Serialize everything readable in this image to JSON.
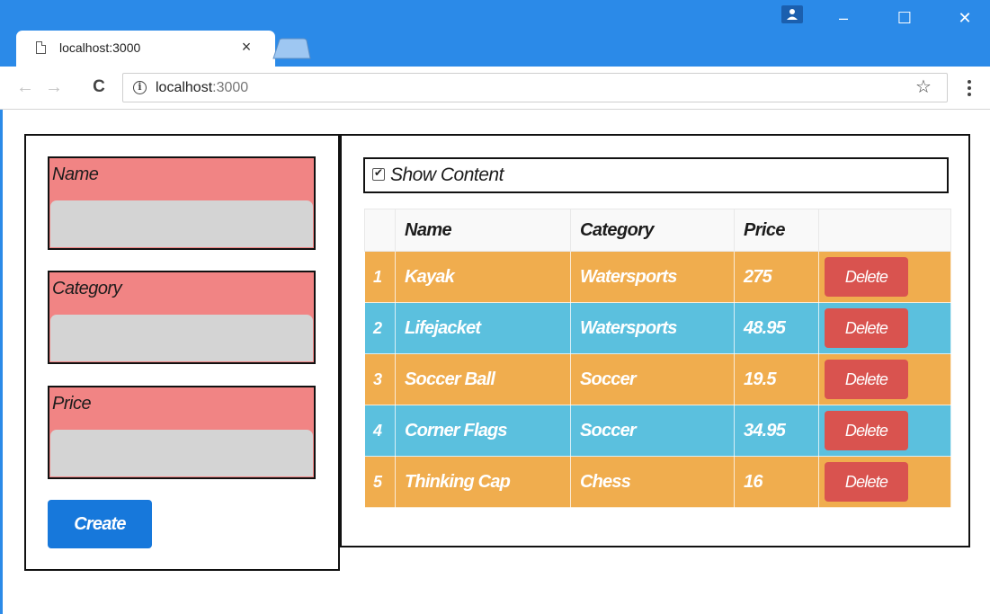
{
  "browser": {
    "tab_title": "localhost:3000",
    "tab_close": "×",
    "url_host": "localhost",
    "url_port": ":3000",
    "window_buttons": {
      "minimize": "–",
      "maximize": "☐",
      "close": "✕"
    }
  },
  "form": {
    "fields": [
      {
        "label": "Name",
        "value": ""
      },
      {
        "label": "Category",
        "value": ""
      },
      {
        "label": "Price",
        "value": ""
      }
    ],
    "create_label": "Create"
  },
  "list": {
    "show_content_label": "Show Content",
    "show_content_checked": true,
    "columns": [
      "",
      "Name",
      "Category",
      "Price",
      ""
    ],
    "rows": [
      {
        "index": "1",
        "name": "Kayak",
        "category": "Watersports",
        "price": "275",
        "action": "Delete",
        "color": "orange"
      },
      {
        "index": "2",
        "name": "Lifejacket",
        "category": "Watersports",
        "price": "48.95",
        "action": "Delete",
        "color": "blue"
      },
      {
        "index": "3",
        "name": "Soccer Ball",
        "category": "Soccer",
        "price": "19.5",
        "action": "Delete",
        "color": "orange"
      },
      {
        "index": "4",
        "name": "Corner Flags",
        "category": "Soccer",
        "price": "34.95",
        "action": "Delete",
        "color": "blue"
      },
      {
        "index": "5",
        "name": "Thinking Cap",
        "category": "Chess",
        "price": "16",
        "action": "Delete",
        "color": "orange"
      }
    ]
  },
  "colors": {
    "chrome_blue": "#2b8ae8",
    "field_label_bg": "#f18484",
    "field_input_bg": "#d4d4d4",
    "create_button": "#1778db",
    "row_orange": "#f0ad4e",
    "row_blue": "#5bc0de",
    "delete_button": "#d9534f"
  },
  "icons": {
    "back": "back-arrow-icon",
    "forward": "forward-arrow-icon",
    "reload": "reload-icon",
    "info": "info-icon",
    "bookmark": "star-icon",
    "menu": "kebab-menu-icon",
    "profile": "profile-icon",
    "page": "page-icon"
  }
}
